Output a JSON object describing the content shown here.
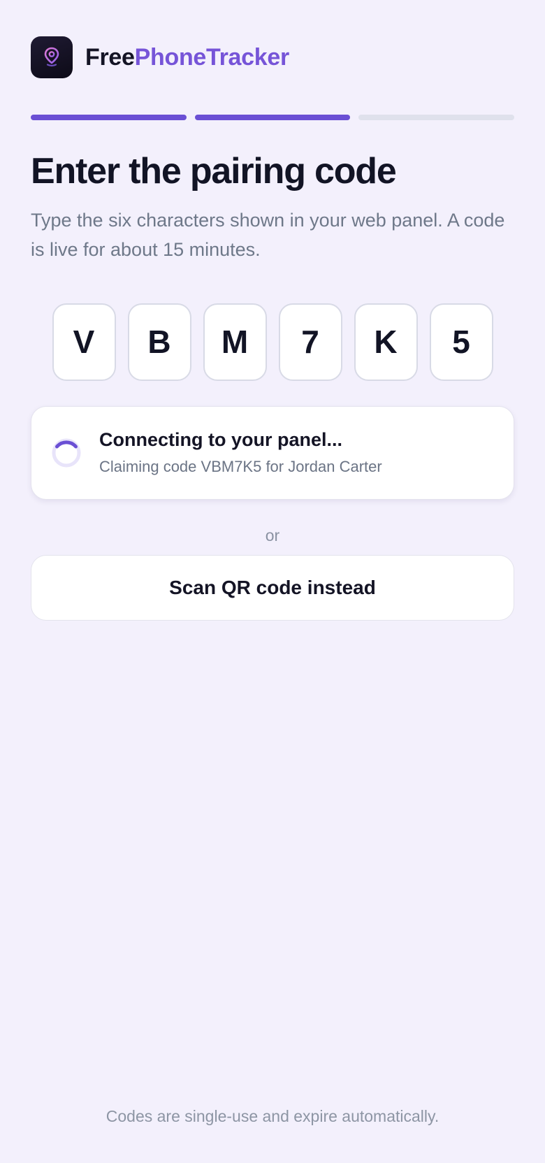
{
  "brand": {
    "name_part1": "Free",
    "name_part2": "PhoneTracker",
    "logo_icon": "location-pin-icon"
  },
  "progress": {
    "steps_total": 3,
    "steps_completed": 2
  },
  "heading": {
    "title": "Enter the pairing code",
    "subtitle": "Type the six characters shown in your web panel. A code is live for about 15 minutes."
  },
  "code": {
    "chars": [
      "V",
      "B",
      "M",
      "7",
      "K",
      "5"
    ]
  },
  "status": {
    "icon": "spinner-icon",
    "title": "Connecting to your panel...",
    "subtitle": "Claiming code VBM7K5 for Jordan Carter"
  },
  "divider_text": "or",
  "scan_button_label": "Scan QR code instead",
  "footer_text": "Codes are single-use and expire automatically.",
  "colors": {
    "background": "#f3f0fc",
    "accent": "#6a4fd4",
    "brand_accent": "#7654d8",
    "text_primary": "#121425",
    "text_muted": "#6e7889"
  }
}
